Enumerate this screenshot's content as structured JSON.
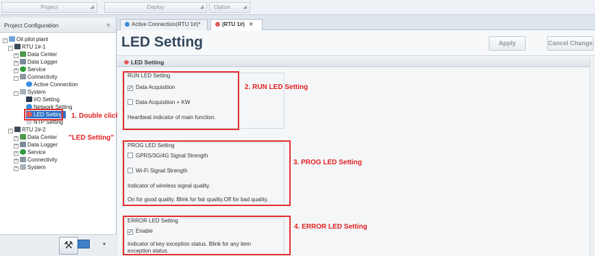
{
  "ribbon": {
    "tabs": [
      {
        "label": "Project"
      },
      {
        "label": "Deploy"
      },
      {
        "label": "Option"
      }
    ]
  },
  "left_panel": {
    "title": "Project Configuration",
    "collapse_glyph": "«",
    "tree": {
      "root": "Oil pilot plant",
      "rtu1": "RTU 1#-1",
      "rtu1_data_center": "Data Center",
      "rtu1_data_logger": "Data Logger",
      "rtu1_service": "Service",
      "rtu1_connectivity": "Connectivity",
      "active_connection": "Active Connection",
      "system": "System",
      "io_setting": "I/O Setting",
      "network_setting": "Network Setting",
      "led_setting": "LED Setting",
      "ntp_setting": "NTP Setting",
      "rtu2": "RTU 2#-2",
      "rtu2_data_center": "Data Center",
      "rtu2_data_logger": "Data Logger",
      "rtu2_service": "Service",
      "rtu2_connectivity": "Connectivity",
      "rtu2_system": "System"
    },
    "annotation_line1": "1. Double click",
    "annotation_line2": "\"LED Setting\"",
    "footer": {
      "tool_icon": "hammer-icon",
      "monitor_icon": "monitor-icon",
      "dropdown_glyph": "▾"
    }
  },
  "doc_tabs": [
    {
      "label": "Active Connection(RTU 1#)*"
    },
    {
      "label": "(RTU 1#)",
      "close": "✕"
    }
  ],
  "header": {
    "title": "LED Setting",
    "apply_label": "Apply",
    "cancel_label": "Cancel Change"
  },
  "section": {
    "title": "LED Setting"
  },
  "run_led": {
    "title": "RUN LED Setting",
    "opt1": "Data Acquisition",
    "opt1_checked": true,
    "opt2": "Data Acquisition + KW",
    "opt2_checked": false,
    "desc": "Heartbeat indicator of main function.",
    "annotation": "2. RUN LED Setting"
  },
  "prog_led": {
    "title": "PROG LED Setting",
    "opt1": "GPRS/3G/4G Signal Strength",
    "opt1_checked": false,
    "opt2": "Wi-Fi Signal Strength",
    "opt2_checked": false,
    "desc1": "Indicator of wireless signal quality.",
    "desc2": "On for good quality. Blink for fair quality.Off for bad quality.",
    "annotation": "3. PROG LED Setting"
  },
  "error_led": {
    "title": "ERROR LED Setting",
    "opt1": "Enable",
    "opt1_checked": true,
    "desc1": "Indicator of key exception status. Blink for any item",
    "desc2": "exception status.",
    "annotation": "4. ERROR LED Setting"
  },
  "colors": {
    "annotation_red": "#e22d2d",
    "selection_blue": "#3173c7",
    "title_color": "#34495e"
  }
}
